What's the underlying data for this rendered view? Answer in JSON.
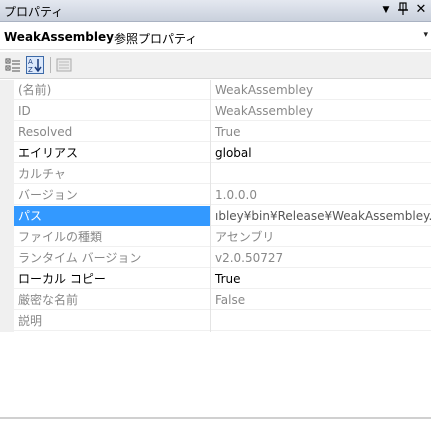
{
  "window": {
    "title": "プロパティ",
    "dropdown_glyph": "▼",
    "pin_glyph": "ᴾ",
    "close_glyph": "✕"
  },
  "object_selector": {
    "name": "WeakAssembley",
    "type": "参照プロパティ",
    "arrow": "▾"
  },
  "properties": [
    {
      "name": "(名前)",
      "value": "WeakAssembley"
    },
    {
      "name": "ID",
      "value": "WeakAssembley"
    },
    {
      "name": "Resolved",
      "value": "True"
    },
    {
      "name": "エイリアス",
      "value": "global"
    },
    {
      "name": "カルチャ",
      "value": ""
    },
    {
      "name": "バージョン",
      "value": "1.0.0.0"
    },
    {
      "name": "パス",
      "value": "ıbley¥bin¥Release¥WeakAssembley.d"
    },
    {
      "name": "ファイルの種類",
      "value": "アセンブリ"
    },
    {
      "name": "ランタイム バージョン",
      "value": "v2.0.50727"
    },
    {
      "name": "ローカル コピー",
      "value": "True"
    },
    {
      "name": "厳密な名前",
      "value": "False"
    },
    {
      "name": "説明",
      "value": ""
    }
  ],
  "colors": {
    "selection": "#3399ff",
    "readonly_text": "#888888",
    "editable_text": "#000000"
  }
}
